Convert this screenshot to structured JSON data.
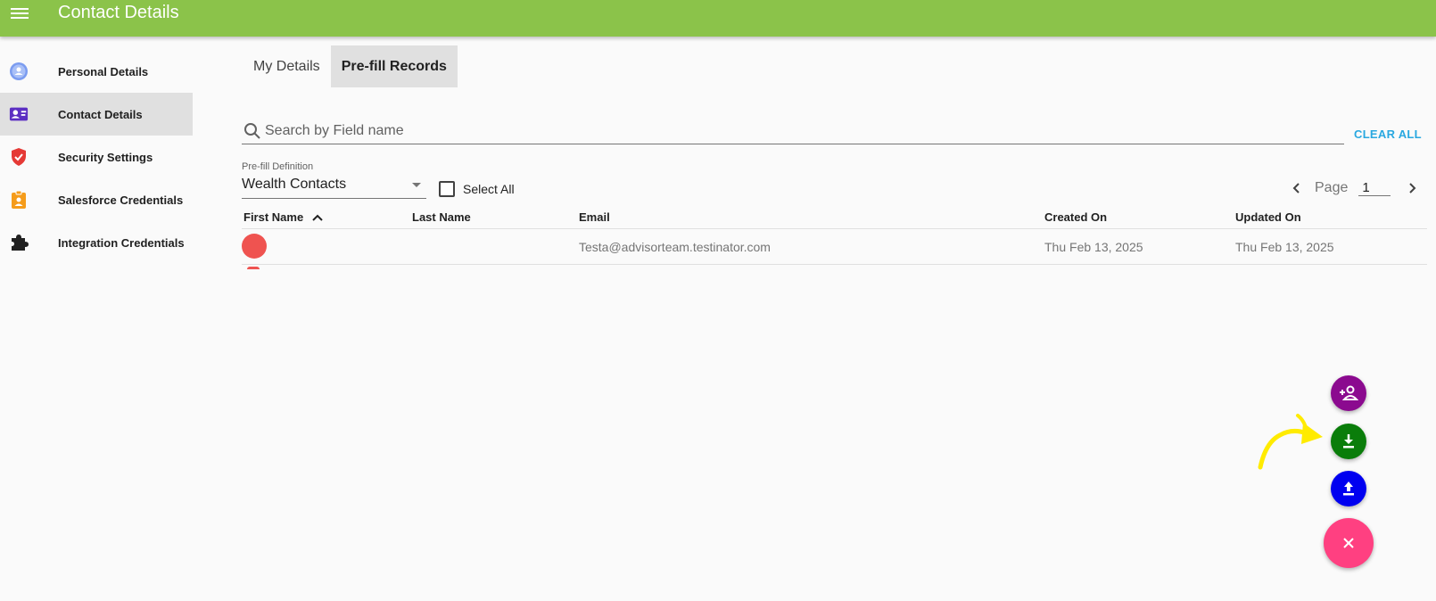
{
  "appbar": {
    "title": "Contact Details",
    "color": "#8bc34a",
    "menu_icon": "hamburger-icon"
  },
  "sidebar": {
    "items": [
      {
        "label": "Personal Details",
        "icon": "person-badge-icon",
        "icon_color": "#7b9cf0",
        "active": false
      },
      {
        "label": "Contact Details",
        "icon": "contact-card-icon",
        "icon_color": "#5c2fc2",
        "active": true
      },
      {
        "label": "Security Settings",
        "icon": "shield-check-icon",
        "icon_color": "#e53935",
        "active": false
      },
      {
        "label": "Salesforce Credentials",
        "icon": "id-badge-icon",
        "icon_color": "#f59c1a",
        "active": false
      },
      {
        "label": "Integration Credentials",
        "icon": "puzzle-icon",
        "icon_color": "#212121",
        "active": false
      }
    ]
  },
  "tabs": [
    {
      "label": "My Details",
      "active": false
    },
    {
      "label": "Pre-fill Records",
      "active": true
    }
  ],
  "search": {
    "placeholder": "Search by Field name",
    "value": "",
    "clear_label": "CLEAR ALL"
  },
  "prefill": {
    "label": "Pre-fill Definition",
    "selected": "Wealth Contacts"
  },
  "select_all": {
    "label": "Select All",
    "checked": false
  },
  "pager": {
    "label": "Page",
    "value": "1"
  },
  "table": {
    "columns": [
      "First Name",
      "Last Name",
      "Email",
      "Created On",
      "Updated On"
    ],
    "sort_column": "First Name",
    "sort_direction": "ascending",
    "rows": [
      {
        "first_name": "",
        "last_name": "",
        "email": "Testa@advisorteam.testinator.com",
        "created_on": "Thu Feb 13, 2025",
        "updated_on": "Thu Feb 13, 2025"
      }
    ]
  },
  "fabs": [
    {
      "name": "add-person",
      "icon": "person-add-icon",
      "color": "#8b0a8f"
    },
    {
      "name": "download",
      "icon": "download-icon",
      "color": "#0a7d0a"
    },
    {
      "name": "upload",
      "icon": "upload-icon",
      "color": "#0000f0"
    },
    {
      "name": "close",
      "icon": "close-icon",
      "color": "#ff4081"
    }
  ],
  "annotation": {
    "icon": "curved-arrow-icon",
    "color": "#ffeb00"
  }
}
